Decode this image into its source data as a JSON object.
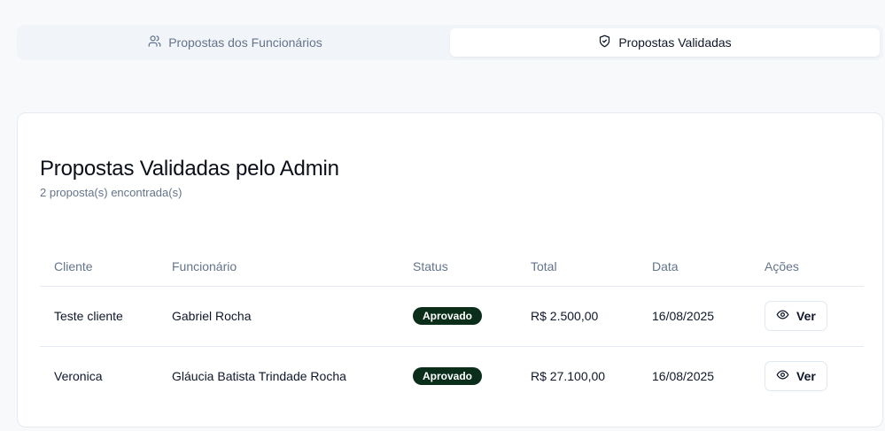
{
  "tabs": [
    {
      "label": "Propostas dos Funcionários",
      "icon": "users-icon",
      "active": false
    },
    {
      "label": "Propostas Validadas",
      "icon": "shield-check-icon",
      "active": true
    }
  ],
  "card": {
    "title": "Propostas Validadas pelo Admin",
    "subtitle": "2 proposta(s) encontrada(s)"
  },
  "table": {
    "headers": [
      "Cliente",
      "Funcionário",
      "Status",
      "Total",
      "Data",
      "Ações"
    ],
    "rows": [
      {
        "cliente": "Teste cliente",
        "funcionario": "Gabriel Rocha",
        "status": "Aprovado",
        "total": "R$ 2.500,00",
        "data": "16/08/2025",
        "action": "Ver"
      },
      {
        "cliente": "Veronica",
        "funcionario": "Gláucia Batista Trindade Rocha",
        "status": "Aprovado",
        "total": "R$ 27.100,00",
        "data": "16/08/2025",
        "action": "Ver"
      }
    ]
  },
  "colors": {
    "badge_bg": "#0b2e1a",
    "page_bg": "#f8f9fb",
    "muted_text": "#64748b"
  }
}
